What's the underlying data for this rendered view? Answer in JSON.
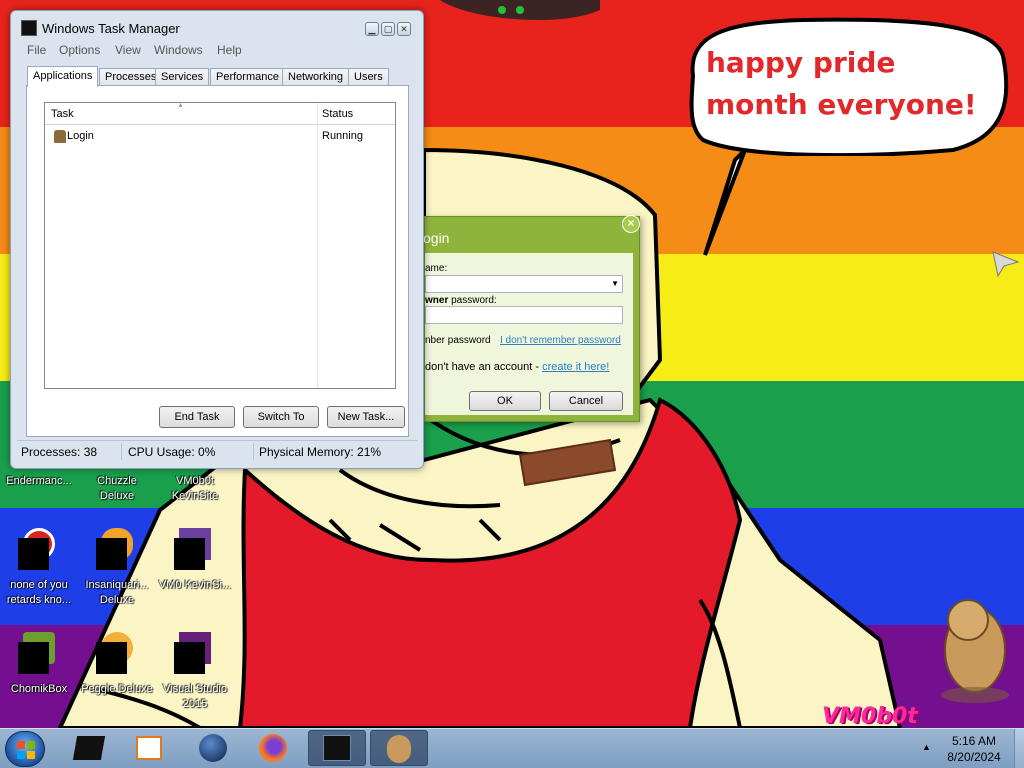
{
  "desktop": {
    "speech_bubble_text": "happy pride month everyone!",
    "watermark_text": "VM0b0t"
  },
  "task_manager": {
    "title": "Windows Task Manager",
    "menu": [
      "File",
      "Options",
      "View",
      "Windows",
      "Help"
    ],
    "tabs": [
      "Applications",
      "Processes",
      "Services",
      "Performance",
      "Networking",
      "Users"
    ],
    "active_tab": "Applications",
    "columns": {
      "task": "Task",
      "status": "Status"
    },
    "tasks": [
      {
        "name": "Login",
        "status": "Running"
      }
    ],
    "buttons": {
      "end_task": "End Task",
      "switch_to": "Switch To",
      "new_task": "New Task..."
    },
    "status_bar": {
      "processes": "Processes: 38",
      "cpu": "CPU Usage: 0%",
      "memory": "Physical Memory: 21%"
    }
  },
  "login_dialog": {
    "title": "ogin",
    "close_glyph": "×",
    "name_label": "ame:",
    "password_label_bold": "wner",
    "password_label_rest": " password:",
    "remember_text": "nber password",
    "forgot_link": "I don't remember password",
    "noaccount_text": "don't have an account - ",
    "create_link": "create it here!",
    "ok_label": "OK",
    "cancel_label": "Cancel"
  },
  "desktop_icons": [
    {
      "label": "Endermanc..."
    },
    {
      "label": "Chuzzle Deluxe"
    },
    {
      "label": "VM0b0t KevinSite"
    },
    {
      "label": "none of you retards kno..."
    },
    {
      "label": "Insaniquari... Deluxe"
    },
    {
      "label": "VM0 KevinSi..."
    },
    {
      "label": "ChomikBox"
    },
    {
      "label": "Peggle Deluxe"
    },
    {
      "label": "Visual Studio 2015"
    }
  ],
  "taskbar": {
    "time": "5:16 AM",
    "date": "8/20/2024",
    "tray_arrow": "▲",
    "items": [
      "black-box",
      "media-player",
      "browser-globe",
      "firefox",
      "task-manager",
      "hamster"
    ]
  },
  "colors": {
    "stripe_red": "#e8231d",
    "stripe_orange": "#f58c16",
    "stripe_yellow": "#f6ec16",
    "stripe_green": "#1aa04c",
    "stripe_blue": "#1e3ee8",
    "stripe_purple": "#74108f",
    "bubble_text": "#e2282a",
    "login_header": "#8fb43c"
  }
}
